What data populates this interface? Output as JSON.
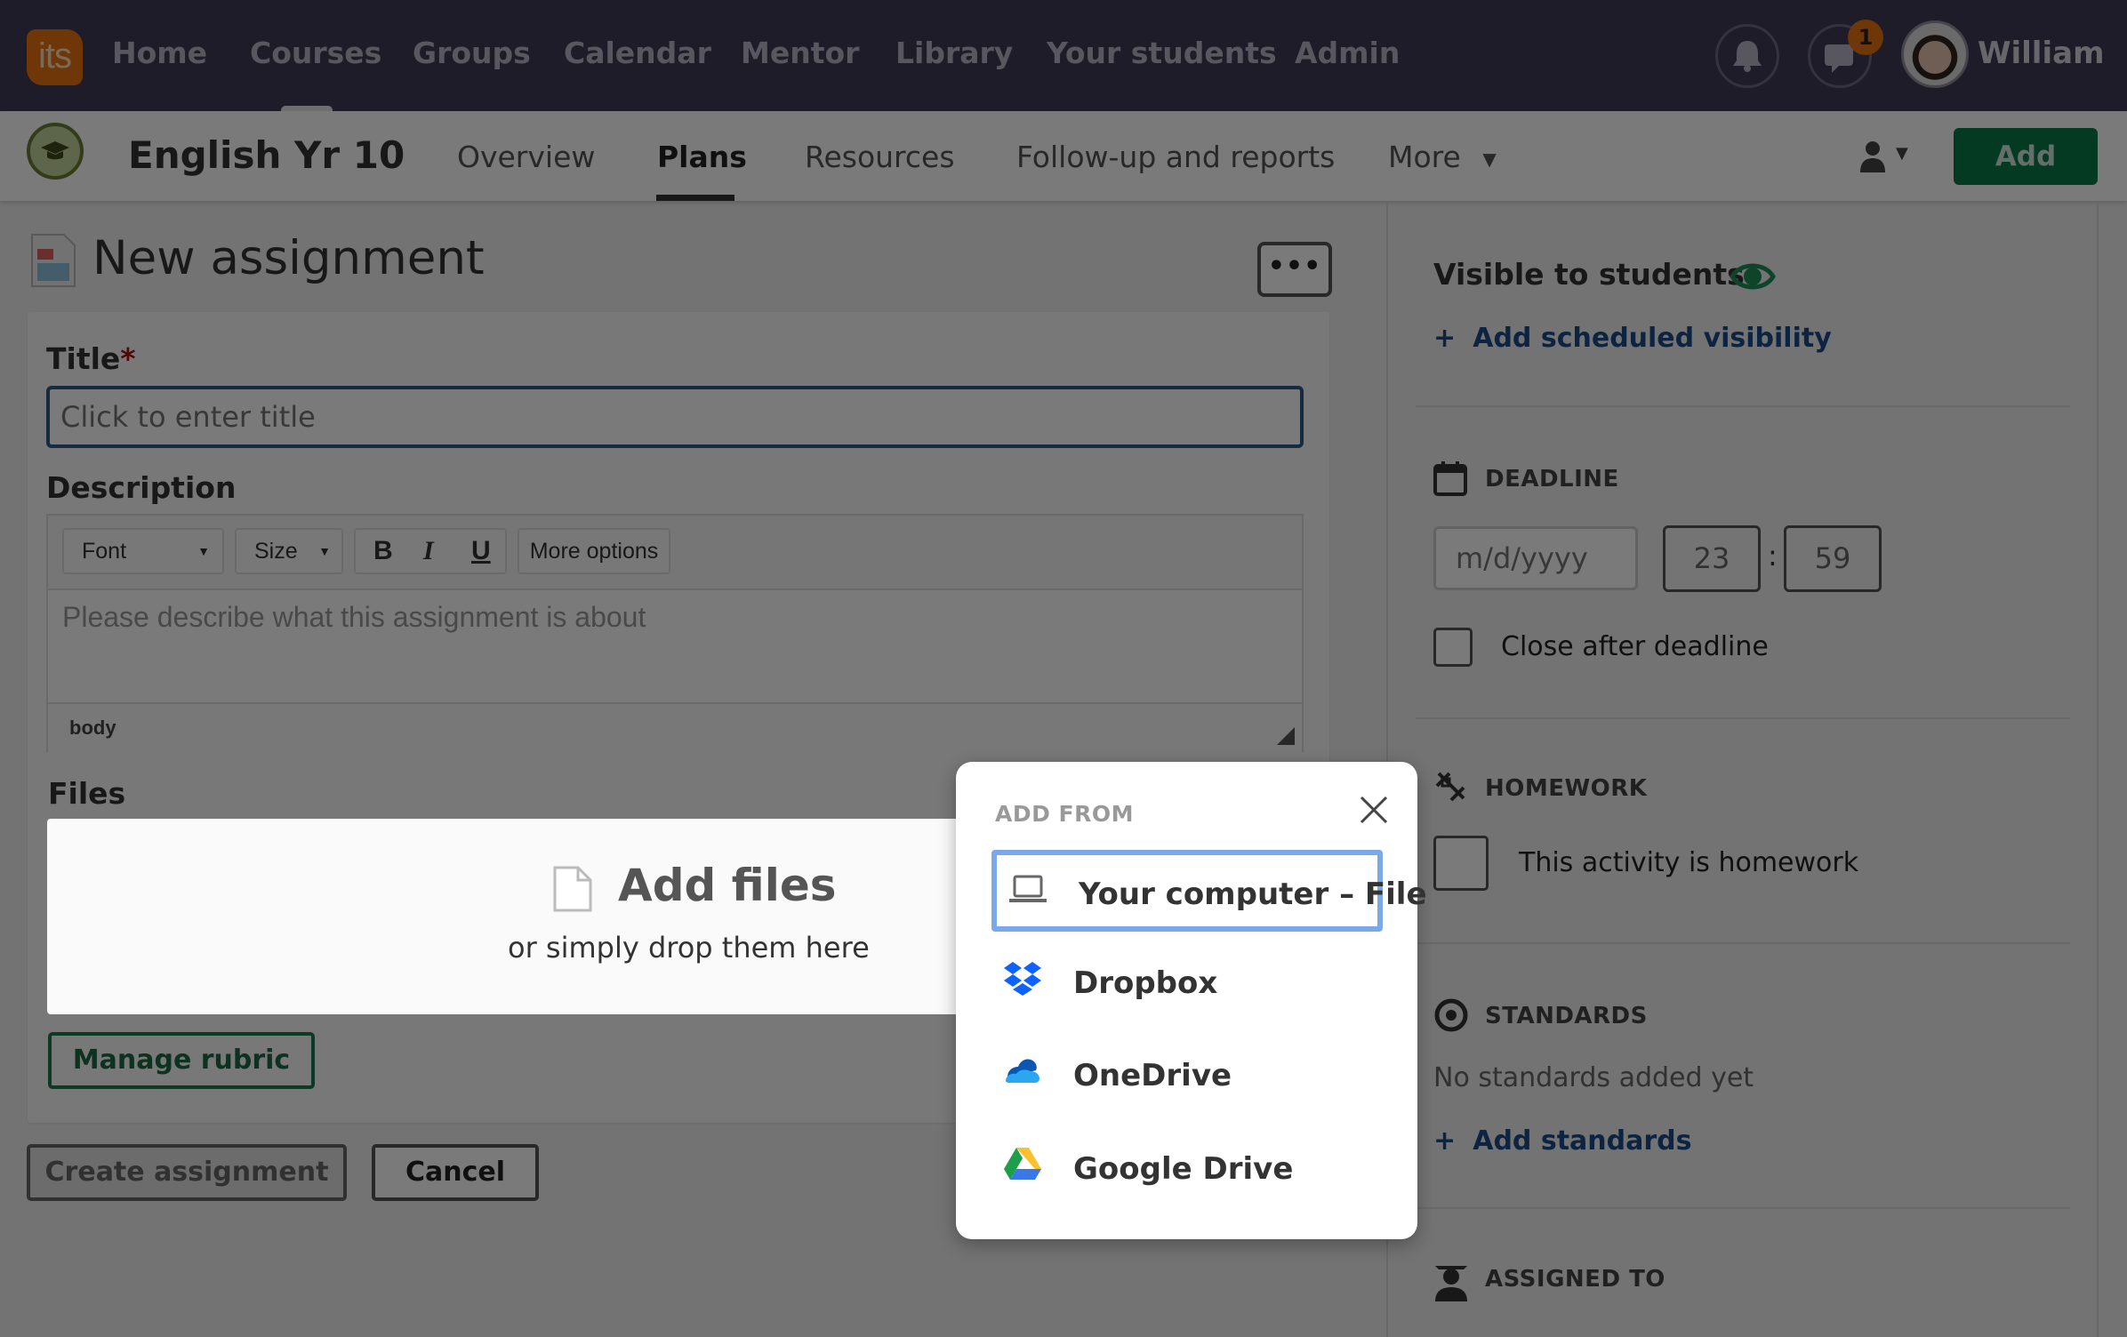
{
  "topnav": {
    "logo_text": "its",
    "items": [
      "Home",
      "Courses",
      "Groups",
      "Calendar",
      "Mentor",
      "Library",
      "Your students",
      "Admin"
    ],
    "active_item": "Courses",
    "notifications_icon": "bell-icon",
    "messages_icon": "chat-icon",
    "messages_badge": "1",
    "user_name": "William"
  },
  "subnav": {
    "course_title": "English Yr 10",
    "tabs": [
      "Overview",
      "Plans",
      "Resources",
      "Follow-up and reports",
      "More"
    ],
    "active_tab": "Plans",
    "add_label": "Add"
  },
  "page": {
    "title": "New assignment",
    "more_label": "•••"
  },
  "form": {
    "title_label": "Title",
    "title_required": "*",
    "title_placeholder": "Click to enter title",
    "description_label": "Description",
    "toolbar": {
      "font": "Font",
      "size": "Size",
      "bold": "B",
      "italic": "I",
      "underline": "U",
      "more_options": "More options"
    },
    "description_placeholder": "Please describe what this assignment is about",
    "status_path": "body",
    "files_label": "Files",
    "add_files": "Add files",
    "drop_hint": "or simply drop them here",
    "manage_rubric": "Manage rubric",
    "create": "Create assignment",
    "cancel": "Cancel"
  },
  "sidebar": {
    "visibility_label": "Visible to students",
    "add_scheduled_visibility": "Add scheduled visibility",
    "deadline_title": "DEADLINE",
    "date_placeholder": "m/d/yyyy",
    "hour": "23",
    "time_sep": ":",
    "minute": "59",
    "close_after_deadline": "Close after deadline",
    "homework_title": "HOMEWORK",
    "homework_checkbox": "This activity is homework",
    "standards_title": "STANDARDS",
    "no_standards": "No standards added yet",
    "add_standards": "Add standards",
    "assigned_title": "ASSIGNED TO"
  },
  "popup": {
    "title": "ADD FROM",
    "options": [
      {
        "label": "Your computer – File",
        "icon": "laptop-icon",
        "selected": true
      },
      {
        "label": "Dropbox",
        "icon": "dropbox-icon"
      },
      {
        "label": "OneDrive",
        "icon": "onedrive-icon"
      },
      {
        "label": "Google Drive",
        "icon": "google-drive-icon"
      }
    ]
  },
  "colors": {
    "topnav_bg": "#3e3b55",
    "brand_orange": "#e8730f",
    "primary_green": "#0c7a48",
    "link_blue": "#1a4a8a",
    "focus_blue": "#7aa9ea"
  }
}
